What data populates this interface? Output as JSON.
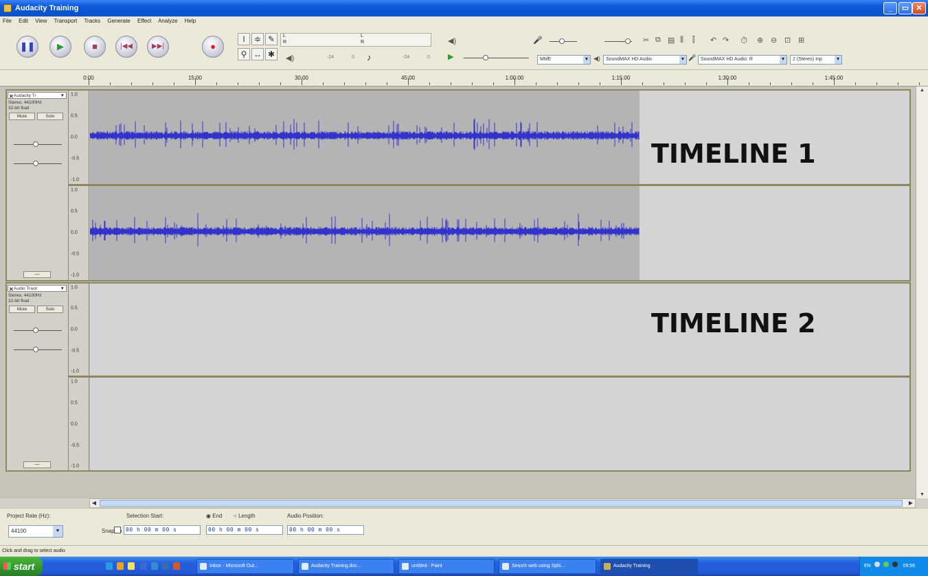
{
  "window": {
    "title": "Audacity Training",
    "buttons": {
      "minimize": "_",
      "restore": "▭",
      "close": "✕"
    }
  },
  "menu": [
    "File",
    "Edit",
    "View",
    "Transport",
    "Tracks",
    "Generate",
    "Effect",
    "Analyze",
    "Help"
  ],
  "transport": {
    "pause": "pause-icon",
    "play": "play-icon",
    "stop": "stop-icon",
    "skip_start": "skip-to-start-icon",
    "skip_end": "skip-to-end-icon",
    "record": "record-icon"
  },
  "meters": {
    "output_L": "L",
    "output_R": "R",
    "input_L": "L",
    "input_R": "R",
    "scale_a": "-24",
    "scale_b": "0",
    "scale_c": "-24",
    "scale_d": "0"
  },
  "devices": {
    "host": "MME",
    "output": "SoundMAX HD Audio",
    "input": "SoundMAX HD Audio: R",
    "channels": "2 (Stereo) Inp"
  },
  "ruler": {
    "labels": [
      "0:00",
      "15:00",
      "30:00",
      "45:00",
      "1:00:00",
      "1:15:00",
      "1:30:00",
      "1:45:00"
    ]
  },
  "tracks": [
    {
      "name": "Audacity Tr",
      "format": "Stereo, 44100Hz",
      "bits": "32-bit float",
      "mute": "Mute",
      "solo": "Solo",
      "overlay": "TIMELINE 1",
      "has_audio": true
    },
    {
      "name": "Audio Track",
      "format": "Stereo, 44100Hz",
      "bits": "32-bit float",
      "mute": "Mute",
      "solo": "Solo",
      "overlay": "TIMELINE 2",
      "has_audio": false
    }
  ],
  "vruler_labels": [
    "1.0",
    "0.5",
    "0.0",
    "-0.5",
    "-1.0"
  ],
  "waveform_color": "#3333cc",
  "selection_toolbar": {
    "project_rate_label": "Project Rate (Hz):",
    "project_rate": "44100",
    "selection_start_label": "Selection Start:",
    "end_label": "End",
    "length_label": "Length",
    "audio_position_label": "Audio Position:",
    "snap_to_label": "Snap To",
    "start_value": "00 h 00 m 00 s",
    "end_value": "00 h 00 m 00 s",
    "position_value": "00 h 00 m 00 s"
  },
  "status": "Click and drag to select audio",
  "taskbar": {
    "start": "start",
    "tasks": [
      "Inbox - Microsoft Out...",
      "Audacity Training.doc...",
      "untitled - Paint",
      "Search web using Sphi...",
      "Audacity Training"
    ],
    "lang": "EN",
    "clock": "09:56"
  }
}
